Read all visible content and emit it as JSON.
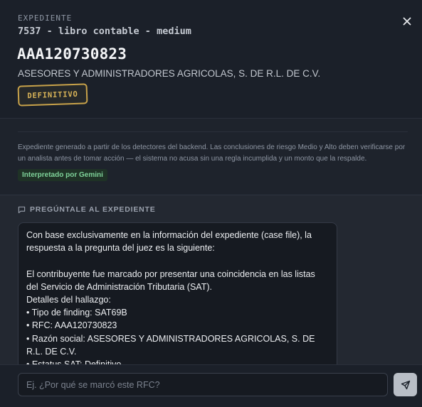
{
  "header": {
    "eyebrow": "EXPEDIENTE",
    "case_title": "7537 - libro contable - medium",
    "close_icon": "close-icon",
    "rfc": "AAA120730823",
    "company": "ASESORES Y ADMINISTRADORES AGRICOLAS, S. DE R.L. DE C.V.",
    "status_badge": "DEFINITIVO"
  },
  "summary": {
    "text": "Expediente generado a partir de los detectores del backend. Las conclusiones de riesgo Medio y Alto deben verificarse por un analista antes de tomar acción — el sistema no acusa sin una regla incumplida y un monto que la respalde.",
    "pill": "Interpretado por Gemini"
  },
  "chat": {
    "section_label": "PREGÚNTALE AL EXPEDIENTE",
    "section_icon": "message-square-icon",
    "answer": "Con base exclusivamente en la información del expediente (case file), la respuesta a la pregunta del juez es la siguiente:\n\nEl contribuyente fue marcado por presentar una coincidencia en las listas del Servicio de Administración Tributaria (SAT).\nDetalles del hallazgo:\n• Tipo de finding: SAT69B\n• RFC: AAA120730823\n• Razón social: ASESORES Y ADMINISTRADORES AGRICOLAS, S. DE R.L. DE C.V.\n• Estatus SAT: Definitivo"
  },
  "composer": {
    "placeholder": "Ej. ¿Por qué se marcó este RFC?",
    "value": "",
    "send_icon": "send-icon"
  },
  "colors": {
    "background": "#1b2029",
    "badge": "#c8a24a",
    "pill_text": "#7fd39a"
  }
}
